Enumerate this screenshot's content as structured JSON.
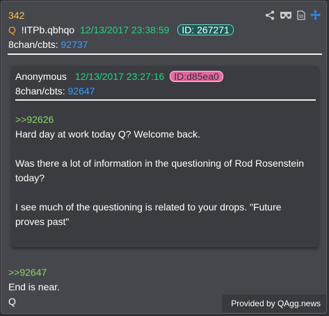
{
  "post": {
    "number": "342",
    "author_letter": "Q",
    "tripcode": "!ITPb.qbhqo",
    "datetime": "12/13/2017 23:38:59",
    "id_label": "ID: 267271",
    "source_prefix": "8chan/cbts:",
    "source_num": "92737"
  },
  "quoted": {
    "author": "Anonymous",
    "datetime": "12/13/2017 23:27:16",
    "id_label": "ID:d85ea0",
    "source_prefix": "8chan/cbts:",
    "source_num": "92647",
    "reply_ref": ">>92626",
    "lines": [
      "Hard day at work today Q? Welcome back.",
      "Was there a lot of information in the questioning of Rod Rosenstein",
      "today?",
      "I see much of the questioning is related to your drops.  \"Future",
      "proves past\""
    ]
  },
  "reply": {
    "ref": ">>92647",
    "line1": "End is near.",
    "line2": "Q"
  },
  "footer": "Provided by QAgg.news",
  "toolbar": {
    "icons": [
      "share-icon",
      "vr-glasses-icon",
      "document-icon",
      "move-icon"
    ]
  },
  "colors": {
    "post_number": "#f7c641",
    "date": "#22d67a",
    "link": "#3c9cff",
    "greentext": "#8fd468",
    "accent_blue": "#2d8cff"
  }
}
